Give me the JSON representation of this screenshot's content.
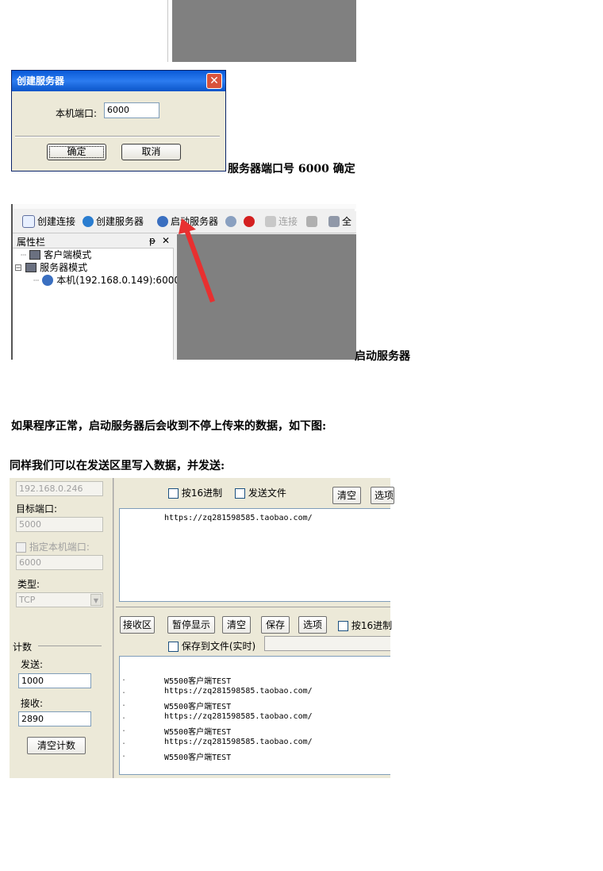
{
  "dialog": {
    "title": "创建服务器",
    "port_label": "本机端口:",
    "port_value": "6000",
    "ok_label": "确定",
    "cancel_label": "取消",
    "close_glyph": "✕"
  },
  "caption1": "服务器端口号 6000  确定",
  "toolbar": {
    "create_connection": "创建连接",
    "create_server": "创建服务器",
    "start_server": "启动服务器",
    "connect": "连接",
    "all_prefix": "全",
    "panel_title": "属性栏",
    "panel_pin": "ᵽ",
    "panel_close": "✕",
    "tree": {
      "client_mode": "客户端模式",
      "server_mode": "服务器模式",
      "local": "本机(192.168.0.149):6000"
    }
  },
  "caption2": "启动服务器",
  "para1": "如果程序正常，启动服务器后会收到不停上传来的数据，如下图:",
  "para2": "同样我们可以在发送区里写入数据，并发送:",
  "app": {
    "ip_value": "192.168.0.246",
    "target_port_label": "目标端口:",
    "target_port_value": "5000",
    "specify_local_port": "指定本机端口:",
    "local_port_value": "6000",
    "type_label": "类型:",
    "type_value": "TCP",
    "count_label": "计数",
    "send_label": "发送:",
    "send_value": "1000",
    "recv_label": "接收:",
    "recv_value": "2890",
    "clear_count": "清空计数",
    "send_hex": "按16进制",
    "send_file": "发送文件",
    "clear_send": "清空",
    "options_send": "选项",
    "send_text": "https://zq281598585.taobao.com/",
    "recv_area": "接收区",
    "pause_display": "暂停显示",
    "clear_recv": "清空",
    "save": "保存",
    "options_recv": "选项",
    "recv_hex": "按16进制",
    "save_to_file": "保存到文件(实时)",
    "recv_lines": [
      "W5500客户端TEST",
      "https://zq281598585.taobao.com/",
      "W5500客户端TEST",
      "https://zq281598585.taobao.com/",
      "W5500客户端TEST",
      "https://zq281598585.taobao.com/",
      "W5500客户端TEST"
    ]
  }
}
